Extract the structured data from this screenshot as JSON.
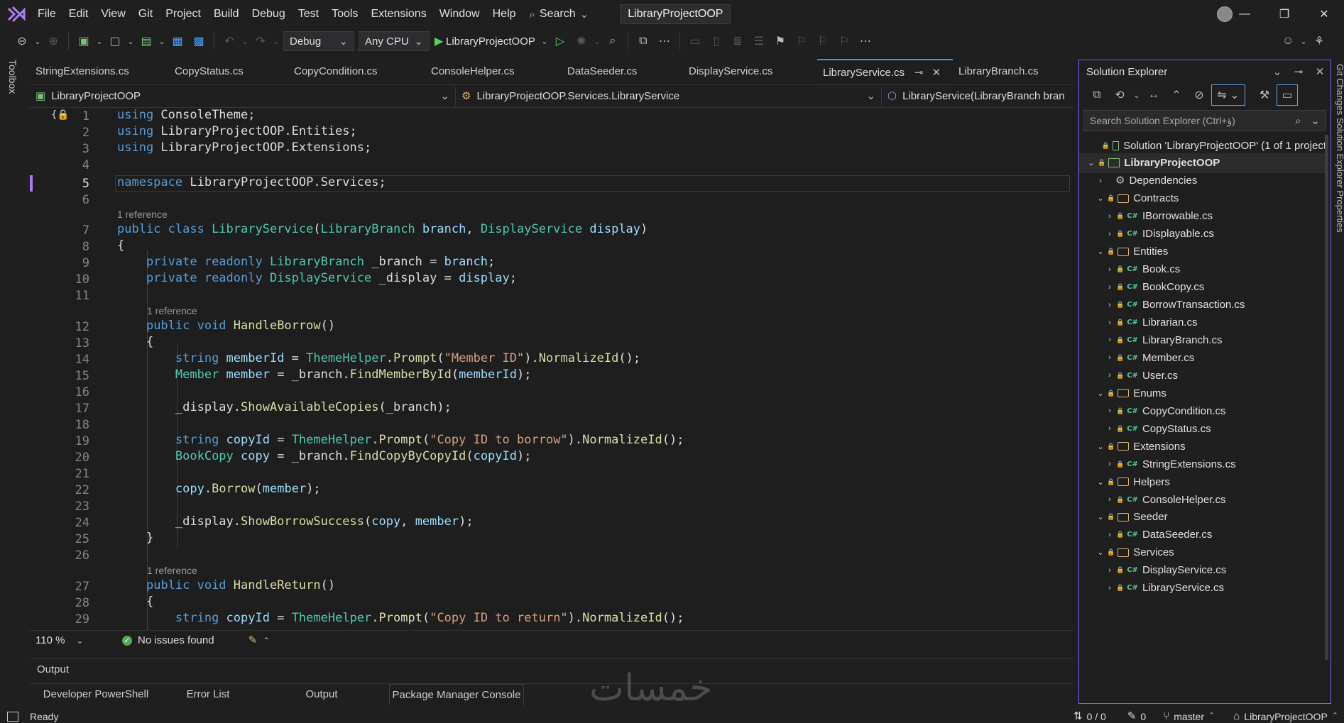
{
  "menu": [
    "File",
    "Edit",
    "View",
    "Git",
    "Project",
    "Build",
    "Debug",
    "Test",
    "Tools",
    "Extensions",
    "Window",
    "Help"
  ],
  "search_label": "Search",
  "solution_title": "LibraryProjectOOP",
  "toolbar": {
    "config": "Debug",
    "platform": "Any CPU",
    "start_target": "LibraryProjectOOP"
  },
  "toolbox_label": "Toolbox",
  "tabs": [
    {
      "label": "StringExtensions.cs"
    },
    {
      "label": "CopyStatus.cs"
    },
    {
      "label": "CopyCondition.cs"
    },
    {
      "label": "ConsoleHelper.cs"
    },
    {
      "label": "DataSeeder.cs"
    },
    {
      "label": "DisplayService.cs"
    },
    {
      "label": "LibraryService.cs"
    },
    {
      "label": "LibraryBranch.cs"
    }
  ],
  "nav": {
    "project": "LibraryProjectOOP",
    "type": "LibraryProjectOOP.Services.LibraryService",
    "member": "LibraryService(LibraryBranch bran"
  },
  "codelens": {
    "ref": "1 reference"
  },
  "code": {
    "l1": [
      [
        "kw",
        "using"
      ],
      [
        "pl",
        " ConsoleTheme;"
      ]
    ],
    "l2": [
      [
        "kw",
        "using"
      ],
      [
        "pl",
        " LibraryProjectOOP.Entities;"
      ]
    ],
    "l3": [
      [
        "kw",
        "using"
      ],
      [
        "pl",
        " LibraryProjectOOP.Extensions;"
      ]
    ],
    "l5": [
      [
        "kw",
        "namespace"
      ],
      [
        "pl",
        " LibraryProjectOOP.Services;"
      ]
    ],
    "l7": [
      [
        "kw",
        "public class "
      ],
      [
        "ty",
        "LibraryService"
      ],
      [
        "pl",
        "("
      ],
      [
        "ty",
        "LibraryBranch"
      ],
      [
        "pl",
        " "
      ],
      [
        "id",
        "branch"
      ],
      [
        "pl",
        ", "
      ],
      [
        "ty",
        "DisplayService"
      ],
      [
        "pl",
        " "
      ],
      [
        "id",
        "display"
      ],
      [
        "pl",
        ")"
      ]
    ],
    "l8": [
      [
        "pl",
        "{"
      ]
    ],
    "l9": [
      [
        "pl",
        "    "
      ],
      [
        "kw",
        "private readonly "
      ],
      [
        "ty",
        "LibraryBranch"
      ],
      [
        "pl",
        " _branch = "
      ],
      [
        "id",
        "branch"
      ],
      [
        "pl",
        ";"
      ]
    ],
    "l10": [
      [
        "pl",
        "    "
      ],
      [
        "kw",
        "private readonly "
      ],
      [
        "ty",
        "DisplayService"
      ],
      [
        "pl",
        " _display = "
      ],
      [
        "id",
        "display"
      ],
      [
        "pl",
        ";"
      ]
    ],
    "l12": [
      [
        "pl",
        "    "
      ],
      [
        "kw",
        "public void "
      ],
      [
        "fn",
        "HandleBorrow"
      ],
      [
        "pl",
        "()"
      ]
    ],
    "l13": [
      [
        "pl",
        "    {"
      ]
    ],
    "l14": [
      [
        "pl",
        "        "
      ],
      [
        "kw",
        "string "
      ],
      [
        "id",
        "memberId"
      ],
      [
        "pl",
        " = "
      ],
      [
        "ty",
        "ThemeHelper"
      ],
      [
        "pl",
        "."
      ],
      [
        "fn",
        "Prompt"
      ],
      [
        "pl",
        "("
      ],
      [
        "st",
        "\"Member ID\""
      ],
      [
        "pl",
        ")."
      ],
      [
        "fn",
        "NormalizeId"
      ],
      [
        "pl",
        "();"
      ]
    ],
    "l15": [
      [
        "pl",
        "        "
      ],
      [
        "ty",
        "Member "
      ],
      [
        "id",
        "member"
      ],
      [
        "pl",
        " = _branch."
      ],
      [
        "fn",
        "FindMemberById"
      ],
      [
        "pl",
        "("
      ],
      [
        "id",
        "memberId"
      ],
      [
        "pl",
        ");"
      ]
    ],
    "l17": [
      [
        "pl",
        "        _display."
      ],
      [
        "fn",
        "ShowAvailableCopies"
      ],
      [
        "pl",
        "(_branch);"
      ]
    ],
    "l19": [
      [
        "pl",
        "        "
      ],
      [
        "kw",
        "string "
      ],
      [
        "id",
        "copyId"
      ],
      [
        "pl",
        " = "
      ],
      [
        "ty",
        "ThemeHelper"
      ],
      [
        "pl",
        "."
      ],
      [
        "fn",
        "Prompt"
      ],
      [
        "pl",
        "("
      ],
      [
        "st",
        "\"Copy ID to borrow\""
      ],
      [
        "pl",
        ")."
      ],
      [
        "fn",
        "NormalizeId"
      ],
      [
        "pl",
        "();"
      ]
    ],
    "l20": [
      [
        "pl",
        "        "
      ],
      [
        "ty",
        "BookCopy "
      ],
      [
        "id",
        "copy"
      ],
      [
        "pl",
        " = _branch."
      ],
      [
        "fn",
        "FindCopyByCopyId"
      ],
      [
        "pl",
        "("
      ],
      [
        "id",
        "copyId"
      ],
      [
        "pl",
        ");"
      ]
    ],
    "l22": [
      [
        "pl",
        "        "
      ],
      [
        "id",
        "copy"
      ],
      [
        "pl",
        "."
      ],
      [
        "fn",
        "Borrow"
      ],
      [
        "pl",
        "("
      ],
      [
        "id",
        "member"
      ],
      [
        "pl",
        ");"
      ]
    ],
    "l24": [
      [
        "pl",
        "        _display."
      ],
      [
        "fn",
        "ShowBorrowSuccess"
      ],
      [
        "pl",
        "("
      ],
      [
        "id",
        "copy"
      ],
      [
        "pl",
        ", "
      ],
      [
        "id",
        "member"
      ],
      [
        "pl",
        ");"
      ]
    ],
    "l25": [
      [
        "pl",
        "    }"
      ]
    ],
    "l27": [
      [
        "pl",
        "    "
      ],
      [
        "kw",
        "public void "
      ],
      [
        "fn",
        "HandleReturn"
      ],
      [
        "pl",
        "()"
      ]
    ],
    "l28": [
      [
        "pl",
        "    {"
      ]
    ],
    "l29": [
      [
        "pl",
        "        "
      ],
      [
        "kw",
        "string "
      ],
      [
        "id",
        "copyId"
      ],
      [
        "pl",
        " = "
      ],
      [
        "ty",
        "ThemeHelper"
      ],
      [
        "pl",
        "."
      ],
      [
        "fn",
        "Prompt"
      ],
      [
        "pl",
        "("
      ],
      [
        "st",
        "\"Copy ID to return\""
      ],
      [
        "pl",
        ")."
      ],
      [
        "fn",
        "NormalizeId"
      ],
      [
        "pl",
        "();"
      ]
    ]
  },
  "editor_status": {
    "zoom": "110 %",
    "issues": "No issues found"
  },
  "output": {
    "title": "Output",
    "tabs": [
      "Developer PowerShell",
      "Error List",
      "Output",
      "Package Manager Console"
    ]
  },
  "watermark": "خمسات",
  "statusbar": {
    "ready": "Ready",
    "updown": "0 / 0",
    "changes": "0",
    "branch": "master",
    "repo": "LibraryProjectOOP"
  },
  "solution_explorer": {
    "title": "Solution Explorer",
    "search_placeholder": "Search Solution Explorer (Ctrl+ؤ)",
    "side_label": "Git Changes  Solution Explorer  Properties",
    "tree": [
      {
        "label": "Solution 'LibraryProjectOOP' (1 of 1 project",
        "kind": "solution",
        "depth": 0,
        "chev": ""
      },
      {
        "label": "LibraryProjectOOP",
        "kind": "project",
        "depth": 0,
        "chev": "v"
      },
      {
        "label": "Dependencies",
        "kind": "deps",
        "depth": 1,
        "chev": ">"
      },
      {
        "label": "Contracts",
        "kind": "folder",
        "depth": 1,
        "chev": "v"
      },
      {
        "label": "IBorrowable.cs",
        "kind": "cs",
        "depth": 2,
        "chev": ">"
      },
      {
        "label": "IDisplayable.cs",
        "kind": "cs",
        "depth": 2,
        "chev": ">"
      },
      {
        "label": "Entities",
        "kind": "folder",
        "depth": 1,
        "chev": "v"
      },
      {
        "label": "Book.cs",
        "kind": "cs",
        "depth": 2,
        "chev": ">"
      },
      {
        "label": "BookCopy.cs",
        "kind": "cs",
        "depth": 2,
        "chev": ">"
      },
      {
        "label": "BorrowTransaction.cs",
        "kind": "cs",
        "depth": 2,
        "chev": ">"
      },
      {
        "label": "Librarian.cs",
        "kind": "cs",
        "depth": 2,
        "chev": ">"
      },
      {
        "label": "LibraryBranch.cs",
        "kind": "cs",
        "depth": 2,
        "chev": ">"
      },
      {
        "label": "Member.cs",
        "kind": "cs",
        "depth": 2,
        "chev": ">"
      },
      {
        "label": "User.cs",
        "kind": "cs",
        "depth": 2,
        "chev": ">"
      },
      {
        "label": "Enums",
        "kind": "folder",
        "depth": 1,
        "chev": "v"
      },
      {
        "label": "CopyCondition.cs",
        "kind": "cs",
        "depth": 2,
        "chev": ">"
      },
      {
        "label": "CopyStatus.cs",
        "kind": "cs",
        "depth": 2,
        "chev": ">"
      },
      {
        "label": "Extensions",
        "kind": "folder",
        "depth": 1,
        "chev": "v"
      },
      {
        "label": "StringExtensions.cs",
        "kind": "cs",
        "depth": 2,
        "chev": ">"
      },
      {
        "label": "Helpers",
        "kind": "folder",
        "depth": 1,
        "chev": "v"
      },
      {
        "label": "ConsoleHelper.cs",
        "kind": "cs",
        "depth": 2,
        "chev": ">"
      },
      {
        "label": "Seeder",
        "kind": "folder",
        "depth": 1,
        "chev": "v"
      },
      {
        "label": "DataSeeder.cs",
        "kind": "cs",
        "depth": 2,
        "chev": ">"
      },
      {
        "label": "Services",
        "kind": "folder",
        "depth": 1,
        "chev": "v"
      },
      {
        "label": "DisplayService.cs",
        "kind": "cs",
        "depth": 2,
        "chev": ">"
      },
      {
        "label": "LibraryService.cs",
        "kind": "cs",
        "depth": 2,
        "chev": ">"
      }
    ]
  }
}
